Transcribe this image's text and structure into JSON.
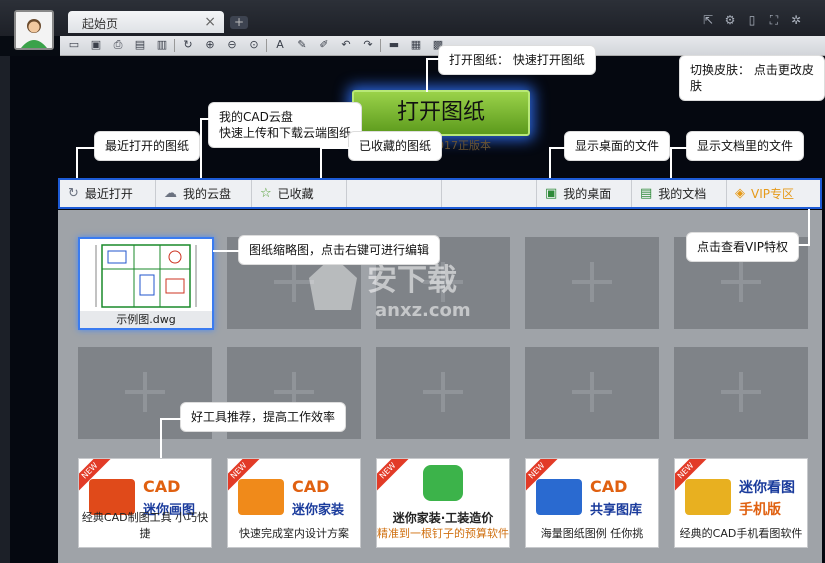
{
  "titlebar": {
    "tab_label": "起始页",
    "tab_close": "×",
    "new_tab": "+"
  },
  "toolbar_icons": [
    "open-folder-icon",
    "save-icon",
    "print-icon",
    "print-preview-icon",
    "lock-icon",
    "rotate-icon",
    "zoom-in-icon",
    "zoom-out-icon",
    "zoom-window-icon",
    "text-icon",
    "pen-icon",
    "highlighter-icon",
    "undo-icon",
    "redo-icon",
    "measure-icon",
    "clapper-icon",
    "calculator-icon"
  ],
  "open_button": "打开图纸",
  "version_text": "2017正版本",
  "nav": {
    "recent": "最近打开",
    "cloud": "我的云盘",
    "favorites": "已收藏",
    "desktop": "我的桌面",
    "documents": "我的文档",
    "vip": "VIP专区"
  },
  "thumb_caption": "示例图.dwg",
  "promos": [
    {
      "badge": "NEW",
      "title": "CAD",
      "subtitle": "迷你画图",
      "desc": "经典CAD制图工具 小巧快捷"
    },
    {
      "badge": "NEW",
      "title": "CAD",
      "subtitle": "迷你家装",
      "desc": "快速完成室内设计方案"
    },
    {
      "badge": "NEW",
      "title": "迷你家装·工装造价",
      "subtitle": "",
      "desc": "精准到一根钉子的预算软件"
    },
    {
      "badge": "NEW",
      "title": "CAD",
      "subtitle": "共享图库",
      "desc": "海量图纸图例 任你挑"
    },
    {
      "badge": "NEW",
      "title": "迷你看图",
      "subtitle": "手机版",
      "desc": "经典的CAD手机看图软件"
    }
  ],
  "callouts": {
    "open": "打开图纸： 快速打开图纸",
    "skin": "切换皮肤： 点击更改皮肤",
    "cloud": "我的CAD云盘\n快速上传和下载云端图纸",
    "recent": "最近打开的图纸",
    "favorites": "已收藏的图纸",
    "desktop": "显示桌面的文件",
    "documents": "显示文档里的文件",
    "thumb": "图纸缩略图，点击右键可进行编辑",
    "vip": "点击查看VIP特权",
    "tools": "好工具推荐，提高工作效率"
  },
  "watermark": "安下载 anxz.com"
}
